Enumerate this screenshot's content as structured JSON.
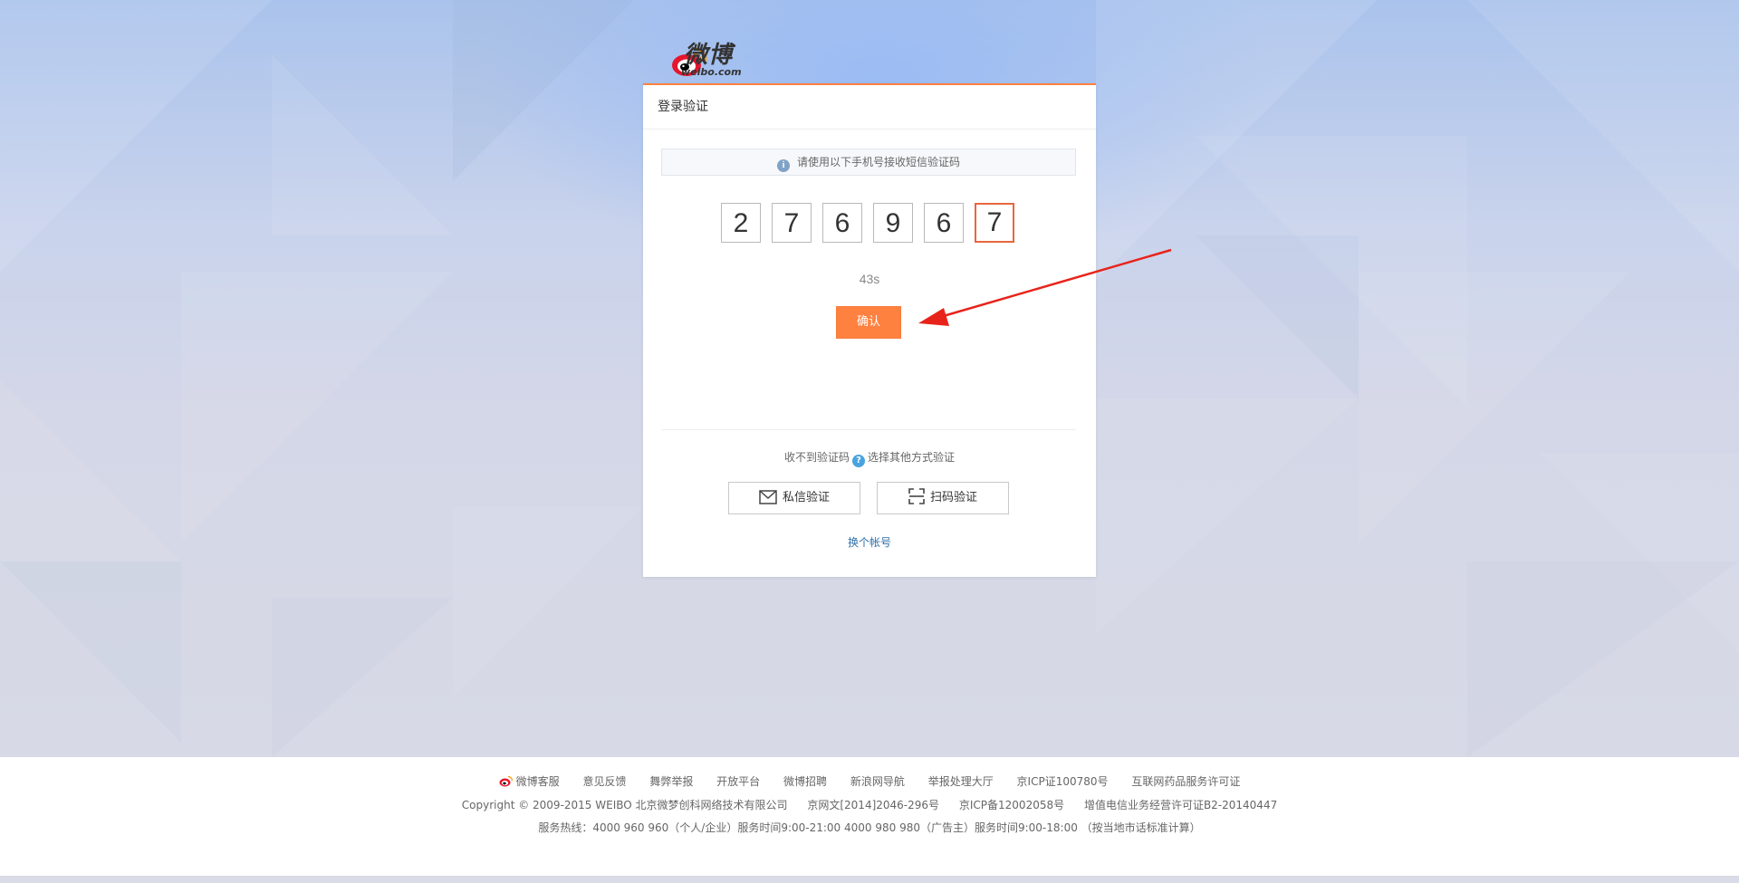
{
  "logo": {
    "name": "微博",
    "domain": "weibo.com"
  },
  "card": {
    "title": "登录验证",
    "tip": "请使用以下手机号接收短信验证码",
    "code_digits": [
      "2",
      "7",
      "6",
      "9",
      "6",
      "7"
    ],
    "countdown": "43s",
    "confirm_label": "确认",
    "alt_prefix": "收不到验证码",
    "alt_suffix": "选择其他方式验证",
    "private_msg_label": "私信验证",
    "scan_label": "扫码验证",
    "switch_account_label": "换个帐号"
  },
  "footer": {
    "links": [
      "微博客服",
      "意见反馈",
      "舞弊举报",
      "开放平台",
      "微博招聘",
      "新浪网导航",
      "举报处理大厅",
      "京ICP证100780号",
      "互联网药品服务许可证"
    ],
    "row2": [
      "Copyright © 2009-2015 WEIBO 北京微梦创科网络技术有限公司",
      "京网文[2014]2046-296号",
      "京ICP备12002058号",
      "增值电信业务经营许可证B2-20140447"
    ],
    "row3": "服务热线：4000 960 960（个人/企业）服务时间9:00-21:00 4000 980 980（广告主）服务时间9:00-18:00 （按当地市话标准计算）"
  },
  "colors": {
    "accent": "#ff8140",
    "active_border": "#e8663d",
    "link": "#2c6fa8",
    "arrow": "#e8231b"
  }
}
